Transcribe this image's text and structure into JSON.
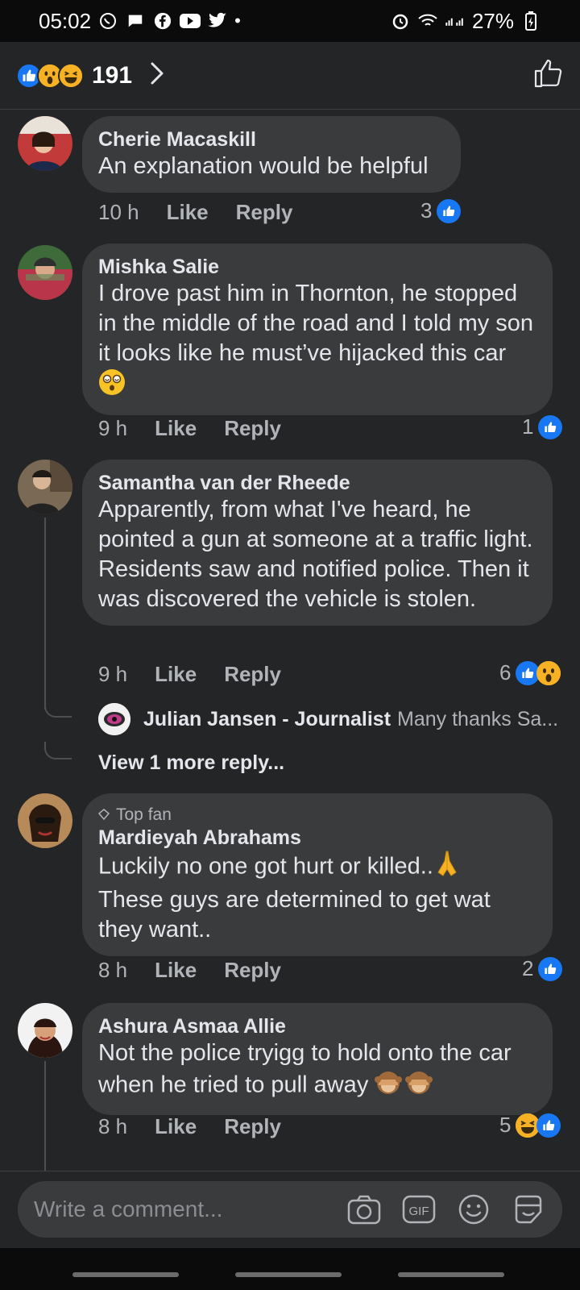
{
  "status_bar": {
    "time": "05:02",
    "battery": "27%",
    "icons": [
      "whatsapp-icon",
      "chat-icon",
      "facebook-icon",
      "youtube-icon",
      "twitter-icon",
      "alarm-icon",
      "wifi-icon",
      "signal-icon"
    ]
  },
  "reactions": {
    "count": "191",
    "types": [
      "like",
      "wow",
      "haha"
    ]
  },
  "comments": [
    {
      "author": "Cherie Macaskill",
      "text": "An explanation would be helpful",
      "time": "10 h",
      "like_label": "Like",
      "reply_label": "Reply",
      "reaction_count": "3",
      "reactions": [
        "like"
      ]
    },
    {
      "author": "Mishka Salie",
      "text": "I drove past him in Thornton, he stopped in the middle of the road and I told my son it looks like he must’ve hijacked this car",
      "emoji": "😵‍💫",
      "time": "9 h",
      "like_label": "Like",
      "reply_label": "Reply",
      "reaction_count": "1",
      "reactions": [
        "like"
      ]
    },
    {
      "author": "Samantha van der Rheede",
      "text": "Apparently, from what I've heard, he pointed a gun at someone at a traffic light. Residents saw and notified police. Then it was discovered the vehicle is stolen.",
      "time": "9 h",
      "like_label": "Like",
      "reply_label": "Reply",
      "reaction_count": "6",
      "reactions": [
        "like",
        "wow"
      ],
      "reply_preview": {
        "author": "Julian Jansen - Journalist",
        "text": "Many thanks Sa..."
      },
      "view_more": "View 1 more reply..."
    },
    {
      "badge": "Top fan",
      "author": "Mardieyah Abrahams",
      "text_line1": "Luckily no one got hurt or killed..",
      "emoji": "🙏",
      "text_line2": "These guys are determined to get wat they want..",
      "time": "8 h",
      "like_label": "Like",
      "reply_label": "Reply",
      "reaction_count": "2",
      "reactions": [
        "like"
      ]
    },
    {
      "author": "Ashura Asmaa Allie",
      "text": "Not the police tryigg to hold onto the car when he tried to pull away",
      "emoji": "🙈🙈",
      "time": "8 h",
      "like_label": "Like",
      "reply_label": "Reply",
      "reaction_count": "5",
      "reactions": [
        "haha",
        "like"
      ]
    }
  ],
  "composer": {
    "placeholder": "Write a comment...",
    "icons": [
      "camera-icon",
      "gif-icon",
      "emoji-icon",
      "sticker-icon"
    ]
  },
  "colors": {
    "background": "#242526",
    "bubble": "#3a3b3c",
    "like_blue": "#1877f2",
    "secondary_text": "#b0b3b8"
  }
}
